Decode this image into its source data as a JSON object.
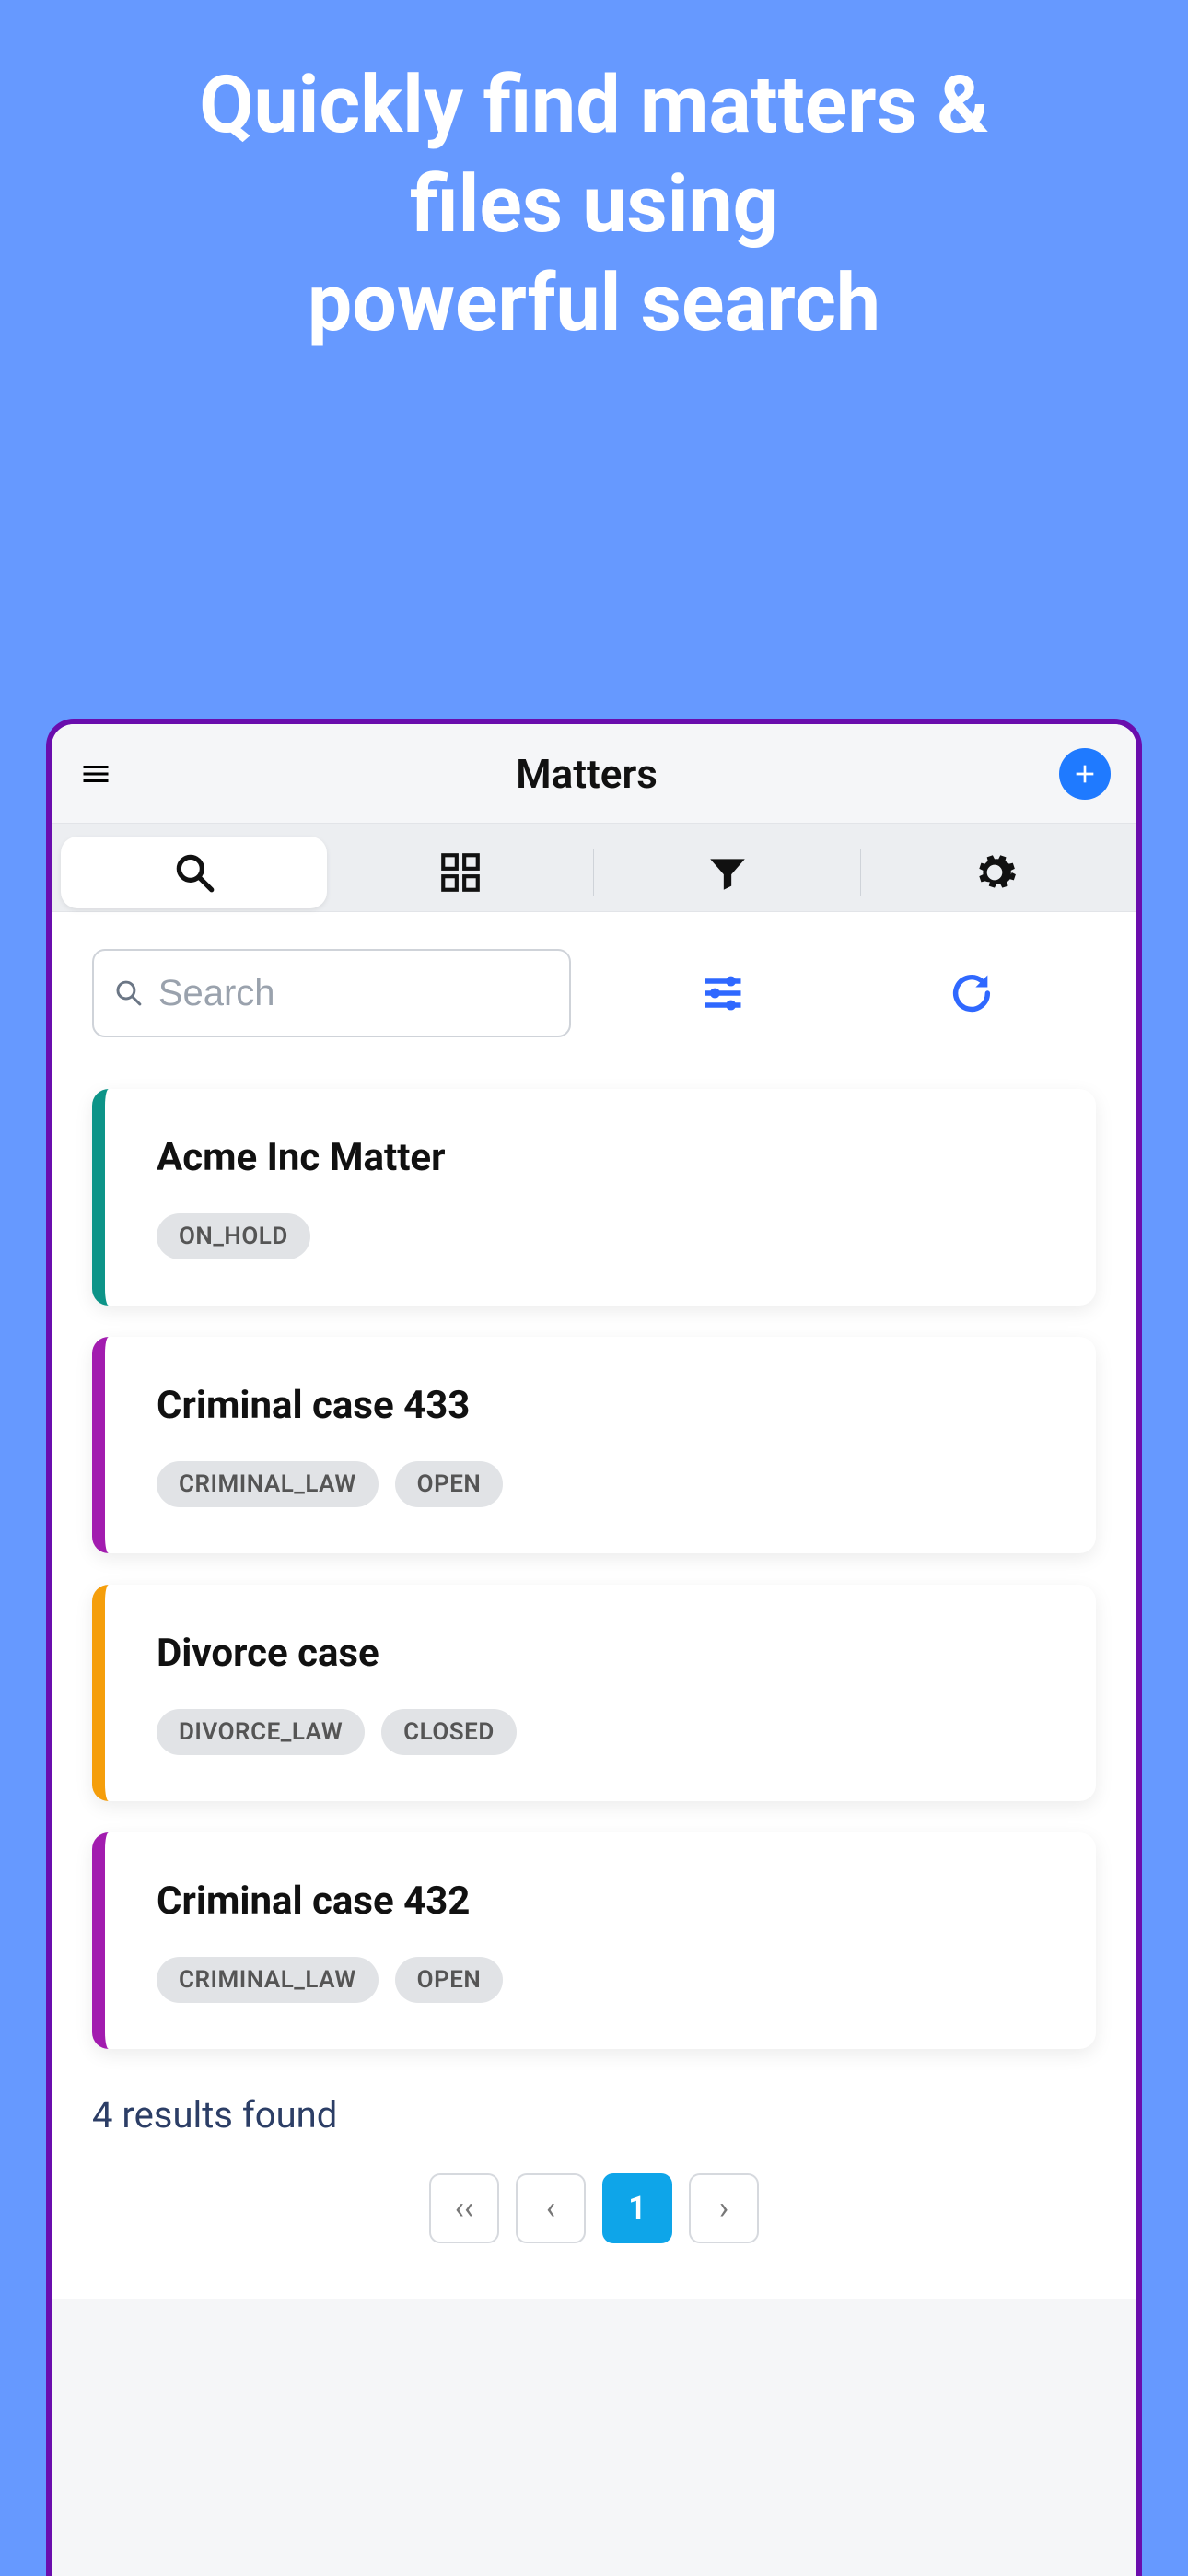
{
  "hero": {
    "line1": "Quickly find matters &",
    "line2": "files using",
    "line3": "powerful search"
  },
  "header": {
    "title": "Matters"
  },
  "search": {
    "placeholder": "Search"
  },
  "matters": [
    {
      "title": "Acme Inc Matter",
      "accent": "#0d9488",
      "tags": [
        "ON_HOLD"
      ]
    },
    {
      "title": "Criminal case 433",
      "accent": "#a21caf",
      "tags": [
        "CRIMINAL_LAW",
        "OPEN"
      ]
    },
    {
      "title": "Divorce case",
      "accent": "#f59e0b",
      "tags": [
        "DIVORCE_LAW",
        "CLOSED"
      ]
    },
    {
      "title": "Criminal case 432",
      "accent": "#a21caf",
      "tags": [
        "CRIMINAL_LAW",
        "OPEN"
      ]
    }
  ],
  "results_text": "4 results found",
  "pager": {
    "first": "‹‹",
    "prev": "‹",
    "current": "1",
    "next": "›"
  }
}
